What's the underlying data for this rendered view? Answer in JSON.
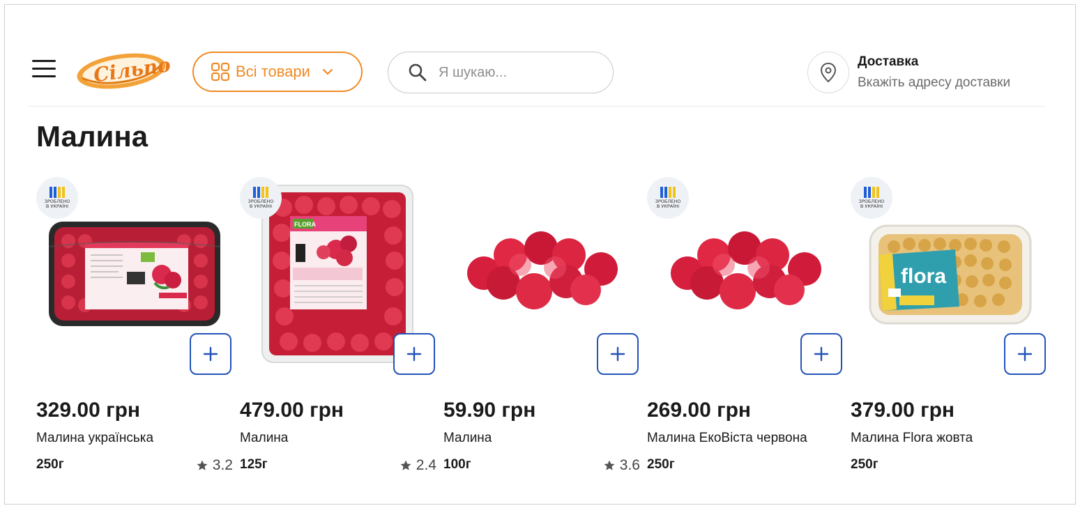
{
  "header": {
    "catalog_label": "Всі товари",
    "search_placeholder": "Я шукаю...",
    "delivery_title": "Доставка",
    "delivery_subtitle": "Вкажіть адресу доставки",
    "logo_text": "Сільпо"
  },
  "colors": {
    "accent_orange": "#f08a24",
    "add_button_blue": "#2352b8",
    "badge_blue": "#1f5fd6",
    "badge_yellow": "#f2c318"
  },
  "page": {
    "title": "Малина"
  },
  "badge": {
    "line1": "ЗРОБЛЕНО",
    "line2": "В УКРАЇНІ"
  },
  "products": [
    {
      "price": "329.00 грн",
      "name": "Малина українська",
      "weight": "250г",
      "rating": "3.2",
      "has_badge": true
    },
    {
      "price": "479.00 грн",
      "name": "Малина",
      "weight": "125г",
      "rating": "2.4",
      "has_badge": true
    },
    {
      "price": "59.90 грн",
      "name": "Малина",
      "weight": "100г",
      "rating": "3.6",
      "has_badge": false
    },
    {
      "price": "269.00 грн",
      "name": "Малина ЕкоВіста червона",
      "weight": "250г",
      "rating": "",
      "has_badge": true
    },
    {
      "price": "379.00 грн",
      "name": "Малина Flora жовта",
      "weight": "250г",
      "rating": "",
      "has_badge": true
    }
  ],
  "icons": {
    "menu": "hamburger-menu-icon",
    "catalog": "grid-icon",
    "dropdown": "chevron-down-icon",
    "search": "search-icon",
    "location": "location-pin-icon",
    "add": "plus-icon",
    "rating": "star-icon"
  }
}
